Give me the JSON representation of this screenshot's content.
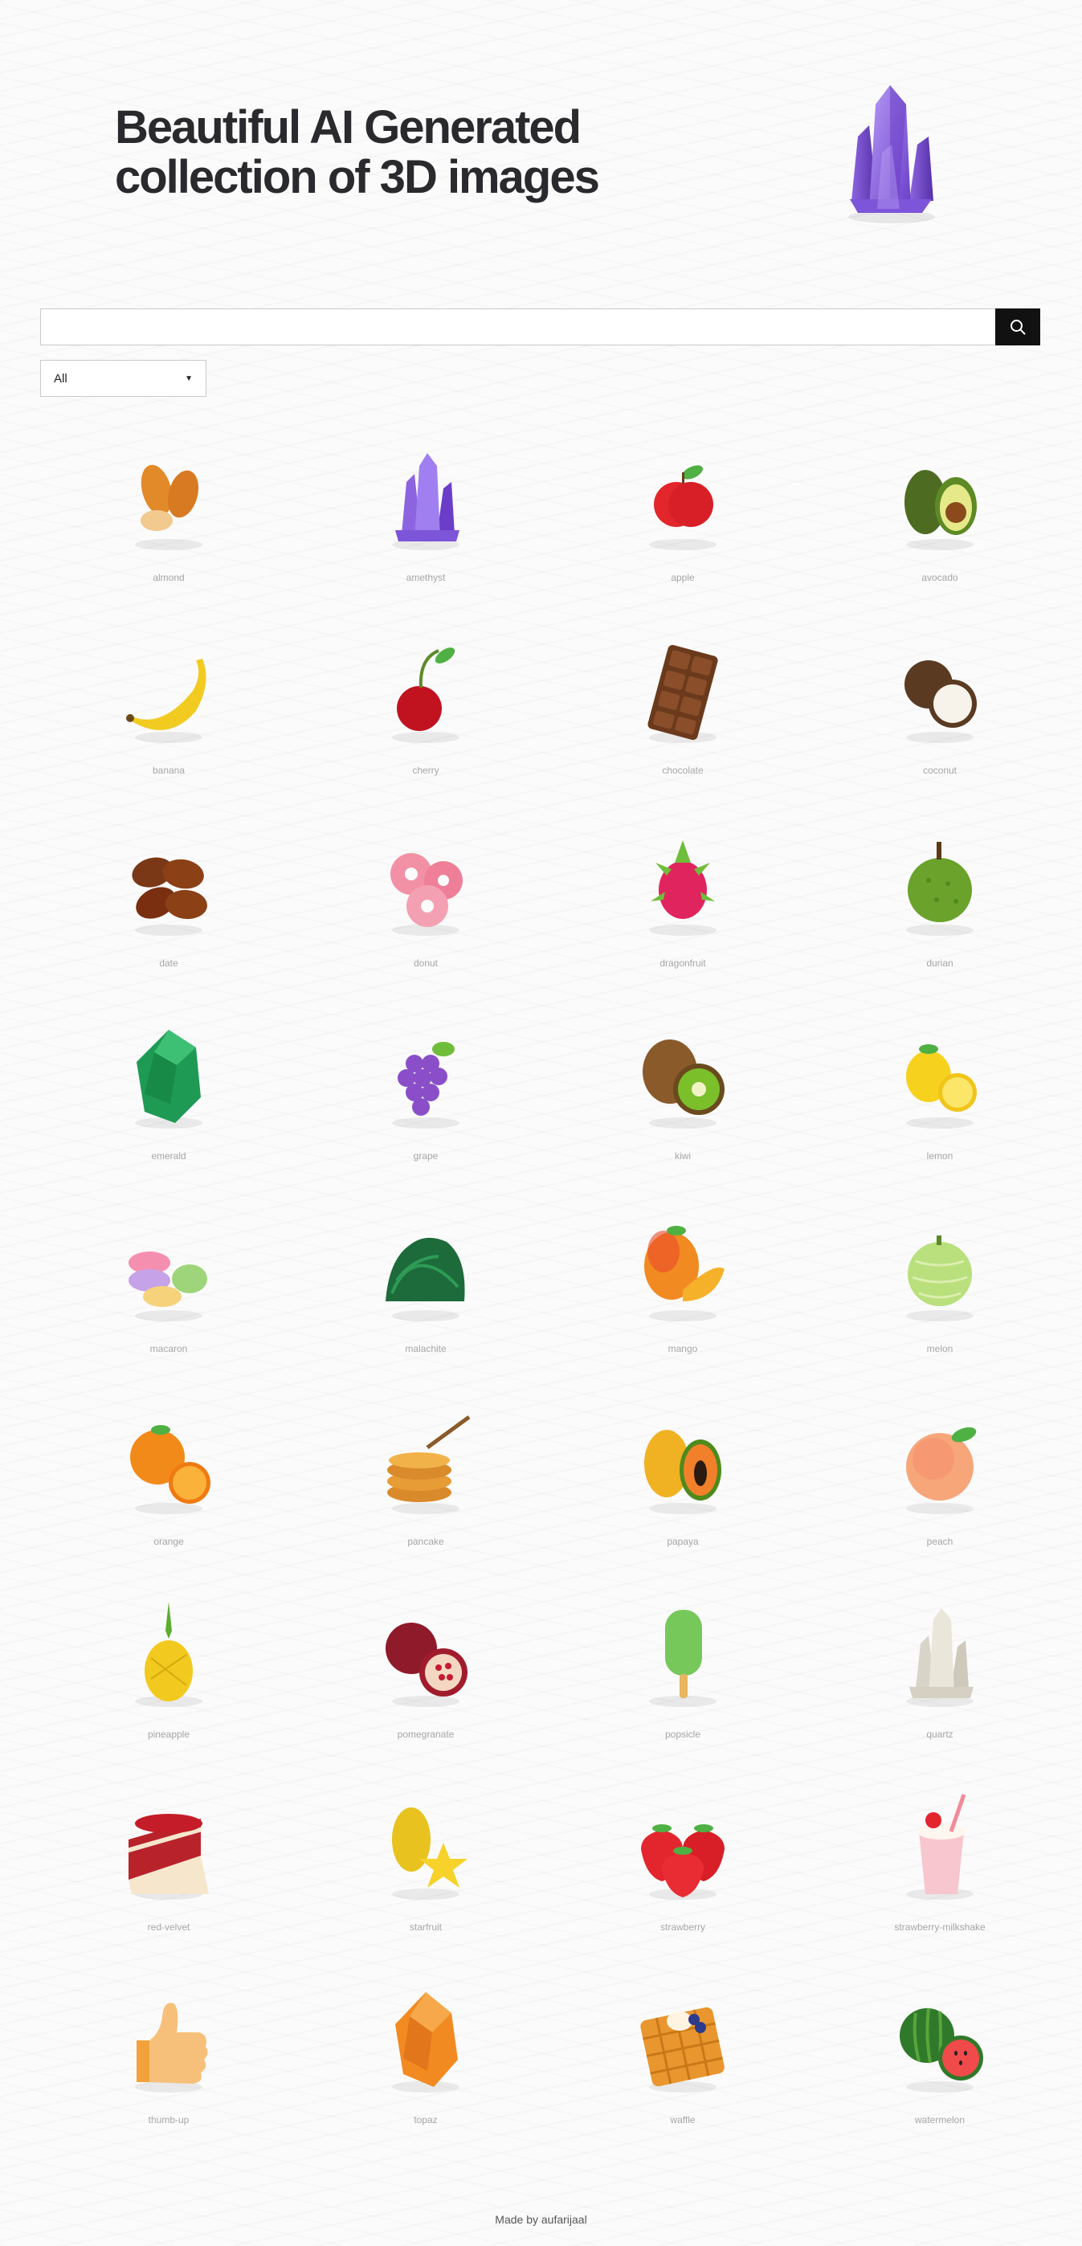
{
  "hero": {
    "title_line1": "Beautiful AI Generated",
    "title_line2": "collection of 3D images",
    "image_icon": "amethyst-crystal-icon"
  },
  "search": {
    "value": "",
    "placeholder": "",
    "button_icon": "search-icon"
  },
  "filter": {
    "selected": "All"
  },
  "items": [
    {
      "label": "almond",
      "icon": "almond"
    },
    {
      "label": "amethyst",
      "icon": "amethyst"
    },
    {
      "label": "apple",
      "icon": "apple"
    },
    {
      "label": "avocado",
      "icon": "avocado"
    },
    {
      "label": "banana",
      "icon": "banana"
    },
    {
      "label": "cherry",
      "icon": "cherry"
    },
    {
      "label": "chocolate",
      "icon": "chocolate"
    },
    {
      "label": "coconut",
      "icon": "coconut"
    },
    {
      "label": "date",
      "icon": "date"
    },
    {
      "label": "donut",
      "icon": "donut"
    },
    {
      "label": "dragonfruit",
      "icon": "dragonfruit"
    },
    {
      "label": "durian",
      "icon": "durian"
    },
    {
      "label": "emerald",
      "icon": "emerald"
    },
    {
      "label": "grape",
      "icon": "grape"
    },
    {
      "label": "kiwi",
      "icon": "kiwi"
    },
    {
      "label": "lemon",
      "icon": "lemon"
    },
    {
      "label": "macaron",
      "icon": "macaron"
    },
    {
      "label": "malachite",
      "icon": "malachite"
    },
    {
      "label": "mango",
      "icon": "mango"
    },
    {
      "label": "melon",
      "icon": "melon"
    },
    {
      "label": "orange",
      "icon": "orange"
    },
    {
      "label": "pancake",
      "icon": "pancake"
    },
    {
      "label": "papaya",
      "icon": "papaya"
    },
    {
      "label": "peach",
      "icon": "peach"
    },
    {
      "label": "pineapple",
      "icon": "pineapple"
    },
    {
      "label": "pomegranate",
      "icon": "pomegranate"
    },
    {
      "label": "popsicle",
      "icon": "popsicle"
    },
    {
      "label": "quartz",
      "icon": "quartz"
    },
    {
      "label": "red-velvet",
      "icon": "red-velvet"
    },
    {
      "label": "starfruit",
      "icon": "starfruit"
    },
    {
      "label": "strawberry",
      "icon": "strawberry"
    },
    {
      "label": "strawberry-milkshake",
      "icon": "strawberry-milkshake"
    },
    {
      "label": "thumb-up",
      "icon": "thumb-up"
    },
    {
      "label": "topaz",
      "icon": "topaz"
    },
    {
      "label": "waffle",
      "icon": "waffle"
    },
    {
      "label": "watermelon",
      "icon": "watermelon"
    }
  ],
  "footer": {
    "text": "Made by aufarijaal"
  }
}
